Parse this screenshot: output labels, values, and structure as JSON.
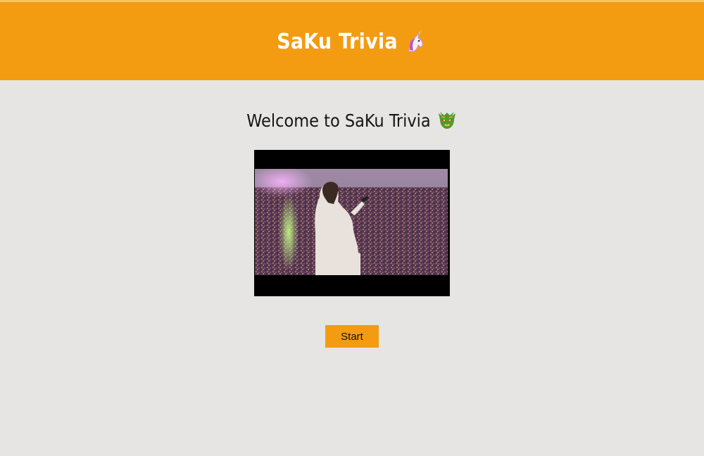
{
  "header": {
    "title": "SaKu Trivia",
    "title_emoji": "unicorn-icon"
  },
  "main": {
    "welcome_text": "Welcome to SaKu Trivia",
    "welcome_emoji": "dragon-icon",
    "start_label": "Start"
  },
  "colors": {
    "accent": "#f39c12",
    "background": "#e6e5e3",
    "header_text": "#ffffff"
  }
}
